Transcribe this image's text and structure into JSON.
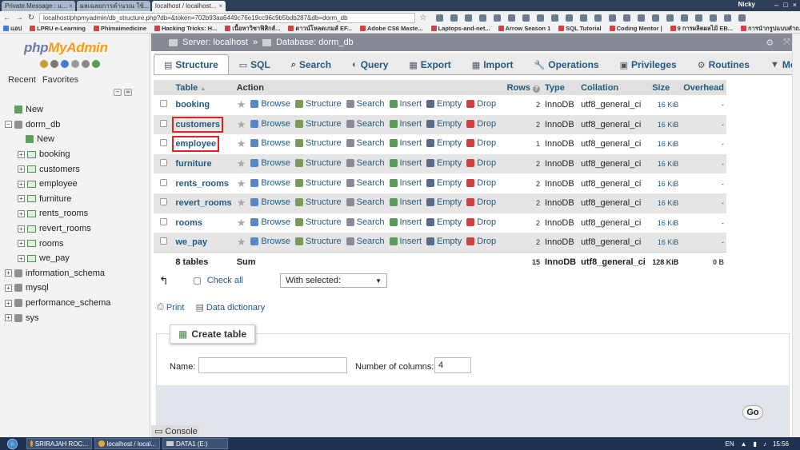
{
  "browser": {
    "tabs": [
      "Private Message : แ...",
      "ผลเฉลยการคำนวณ ใช้...",
      "localhost / localhost..."
    ],
    "user": "Nicky",
    "url": "localhost/phpmyadmin/db_structure.php?db=&token=702b93aa6449c76e19cc96c9b5bdb287&db=dorm_db",
    "bookmarks": [
      "แอป",
      "LPRU e-Learning",
      "Phimaimedicine",
      "Hacking Tricks: H...",
      "เนื้อหาวิชาฟิสิกส์...",
      "ดาวน์โหลดเกมส์ EF...",
      "Adobe CS6 Maste...",
      "Laptops-and-net...",
      "Arrow Season 1",
      "SQL Tutorial",
      "Coding Mentor |",
      "9 การผลิตผลไม้ EB...",
      "การนำกรูปแบบคำถ..."
    ]
  },
  "sidebar": {
    "logo_php": "php",
    "logo_my": "MyAdmin",
    "tab_recent": "Recent",
    "tab_favorites": "Favorites",
    "new_label": "New",
    "open_db": "dorm_db",
    "db_new": "New",
    "db_tables": [
      "booking",
      "customers",
      "employee",
      "furniture",
      "rents_rooms",
      "revert_rooms",
      "rooms",
      "we_pay"
    ],
    "other_dbs": [
      "information_schema",
      "mysql",
      "performance_schema",
      "sys"
    ]
  },
  "breadcrumb": {
    "server": "Server: localhost",
    "sep": "»",
    "database": "Database: dorm_db"
  },
  "menu": [
    "Structure",
    "SQL",
    "Search",
    "Query",
    "Export",
    "Import",
    "Operations",
    "Privileges",
    "Routines",
    "More"
  ],
  "table": {
    "headers": [
      "Table",
      "Action",
      "Rows",
      "Type",
      "Collation",
      "Size",
      "Overhead"
    ],
    "actions": [
      "Browse",
      "Structure",
      "Search",
      "Insert",
      "Empty",
      "Drop"
    ],
    "rows": [
      {
        "name": "booking",
        "rows": "2",
        "type": "InnoDB",
        "collation": "utf8_general_ci",
        "size": "16 KiB",
        "overhead": "-"
      },
      {
        "name": "customers",
        "rows": "2",
        "type": "InnoDB",
        "collation": "utf8_general_ci",
        "size": "16 KiB",
        "overhead": "-"
      },
      {
        "name": "employee",
        "rows": "1",
        "type": "InnoDB",
        "collation": "utf8_general_ci",
        "size": "16 KiB",
        "overhead": "-"
      },
      {
        "name": "furniture",
        "rows": "2",
        "type": "InnoDB",
        "collation": "utf8_general_ci",
        "size": "16 KiB",
        "overhead": "-"
      },
      {
        "name": "rents_rooms",
        "rows": "2",
        "type": "InnoDB",
        "collation": "utf8_general_ci",
        "size": "16 KiB",
        "overhead": "-"
      },
      {
        "name": "revert_rooms",
        "rows": "2",
        "type": "InnoDB",
        "collation": "utf8_general_ci",
        "size": "16 KiB",
        "overhead": "-"
      },
      {
        "name": "rooms",
        "rows": "2",
        "type": "InnoDB",
        "collation": "utf8_general_ci",
        "size": "16 KiB",
        "overhead": "-"
      },
      {
        "name": "we_pay",
        "rows": "2",
        "type": "InnoDB",
        "collation": "utf8_general_ci",
        "size": "16 KiB",
        "overhead": "-"
      }
    ],
    "summary": {
      "tables": "8 tables",
      "label": "Sum",
      "rows": "15",
      "type": "InnoDB",
      "collation": "utf8_general_ci",
      "size": "128 KiB",
      "overhead": "0 B"
    }
  },
  "bulk": {
    "check_all": "Check all",
    "with_selected": "With selected:"
  },
  "links": {
    "print": "Print",
    "data_dictionary": "Data dictionary"
  },
  "create": {
    "button": "Create table",
    "name_label": "Name:",
    "name_value": "",
    "columns_label": "Number of columns:",
    "columns_value": "4",
    "go": "Go"
  },
  "console_label": "Console",
  "taskbar": {
    "items": [
      "SRIRAJAH ROC...",
      "localhost / local...",
      "DATA1 (E:)"
    ],
    "lang": "EN",
    "time": "15:56"
  },
  "colors": {
    "link": "#235a81",
    "highlight_box": "#dd2222",
    "topbar": "#858a95"
  }
}
